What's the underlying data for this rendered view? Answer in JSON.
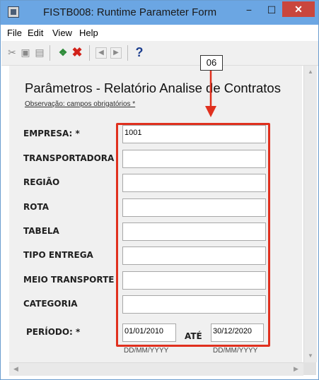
{
  "window": {
    "title": "FISTB008: Runtime Parameter Form",
    "min_glyph": "−",
    "max_glyph": "☐",
    "close_glyph": "✕"
  },
  "menu": [
    "File",
    "Edit",
    "View",
    "Help"
  ],
  "toolbar": {
    "icons": [
      "cut-icon",
      "copy-icon",
      "paste-icon",
      "run-icon",
      "cancel-icon",
      "prev-icon",
      "next-icon",
      "help-icon"
    ]
  },
  "callout": {
    "label": "06",
    "color": "#e0301e"
  },
  "form": {
    "title": "Parâmetros - Relatório Analise de Contratos",
    "note": "Observação: campos obrigatórios *",
    "fields": [
      {
        "label": "EMPRESA: *",
        "value": "1001"
      },
      {
        "label": "TRANSPORTADORA",
        "value": ""
      },
      {
        "label": "REGIÃO",
        "value": ""
      },
      {
        "label": "ROTA",
        "value": ""
      },
      {
        "label": "TABELA",
        "value": ""
      },
      {
        "label": "TIPO ENTREGA",
        "value": ""
      },
      {
        "label": "MEIO TRANSPORTE",
        "value": ""
      },
      {
        "label": "CATEGORIA",
        "value": ""
      }
    ],
    "periodo": {
      "label": "PERÍODO: *",
      "from": "01/01/2010",
      "ate_label": "ATÉ",
      "to": "30/12/2020",
      "format": "DD/MM/YYYY"
    }
  }
}
